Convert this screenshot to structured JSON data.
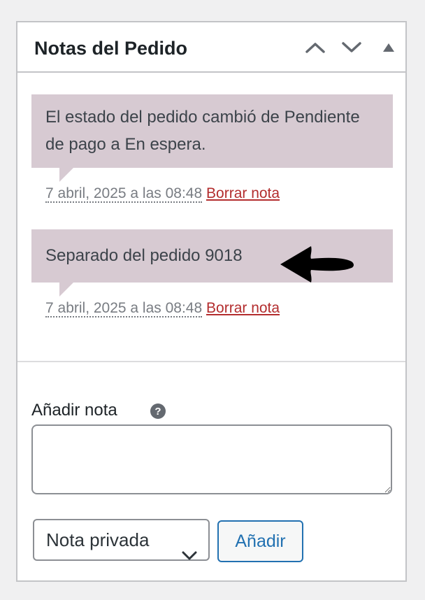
{
  "header": {
    "title": "Notas del Pedido"
  },
  "notes": [
    {
      "text": "El estado del pedido cambió de Pendiente de pago a En espera.",
      "date": "7 abril, 2025 a las 08:48",
      "delete_label": "Borrar nota"
    },
    {
      "text": "Separado del pedido 9018",
      "date": "7 abril, 2025 a las 08:48",
      "delete_label": "Borrar nota"
    }
  ],
  "add_note": {
    "label": "Añadir nota",
    "help_glyph": "?",
    "textarea_value": "",
    "note_type_selected": "Nota privada",
    "submit_label": "Añadir"
  },
  "colors": {
    "note_background": "#d7cad2",
    "delete_link": "#b32d2e",
    "primary": "#2271b1"
  }
}
